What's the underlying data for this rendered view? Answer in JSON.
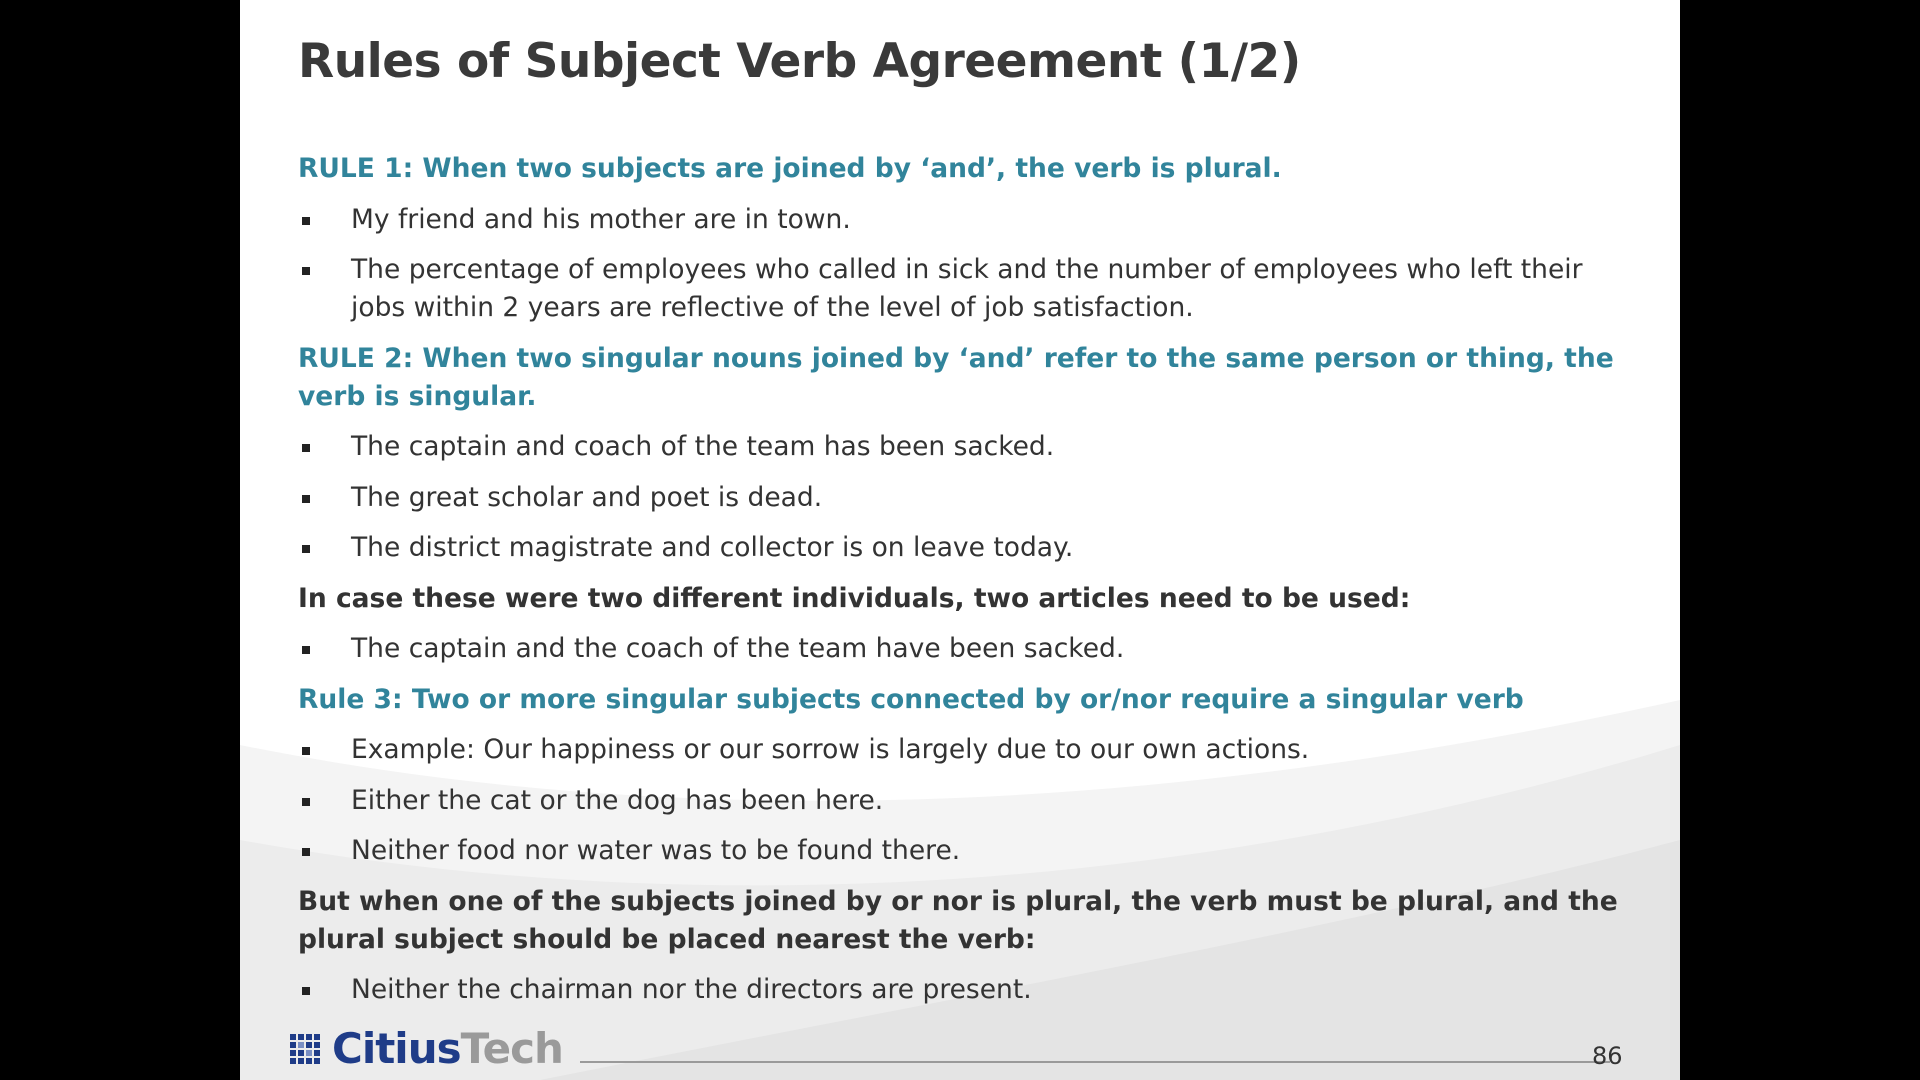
{
  "slide": {
    "title": "Rules of Subject Verb Agreement (1/2)",
    "page_number": "86",
    "logo": {
      "part1": "Citius",
      "part2": "Tech"
    },
    "colors": {
      "accent": "#31849b",
      "text": "#333333",
      "logo_blue": "#1f3c88",
      "logo_gray": "#9a9a9a"
    },
    "blocks": [
      {
        "type": "rule",
        "text": "RULE 1: When two subjects are joined by ‘and’, the verb is plural."
      },
      {
        "type": "bullet",
        "text": "My friend and his mother are in town."
      },
      {
        "type": "bullet",
        "text": "The percentage of employees who called in sick and the number of employees who left their jobs within 2 years are reflective of the level of job satisfaction."
      },
      {
        "type": "rule",
        "text": "RULE 2: When two singular nouns joined by ‘and’ refer to the same person or thing, the verb is singular."
      },
      {
        "type": "bullet",
        "text": "The captain and coach of the team has been sacked."
      },
      {
        "type": "bullet",
        "text": "The great scholar and poet is dead."
      },
      {
        "type": "bullet",
        "text": "The district magistrate and collector is on leave today."
      },
      {
        "type": "note",
        "text": "In case these were two different individuals, two articles need to be used:"
      },
      {
        "type": "bullet",
        "text": "The captain and the coach of the team have been sacked."
      },
      {
        "type": "rule",
        "text": "Rule 3: Two or more singular subjects connected by or/nor require a singular verb"
      },
      {
        "type": "bullet",
        "text": "Example: Our happiness or our sorrow is largely due to our own actions."
      },
      {
        "type": "bullet",
        "text": "Either the cat or the dog has been here."
      },
      {
        "type": "bullet",
        "text": "Neither food nor water was to be found there."
      },
      {
        "type": "note",
        "text": "But when one of the subjects joined by or nor is plural, the verb must be plural, and the plural subject should be placed nearest the verb:"
      },
      {
        "type": "bullet",
        "text": "Neither the chairman nor the directors are present."
      }
    ]
  }
}
